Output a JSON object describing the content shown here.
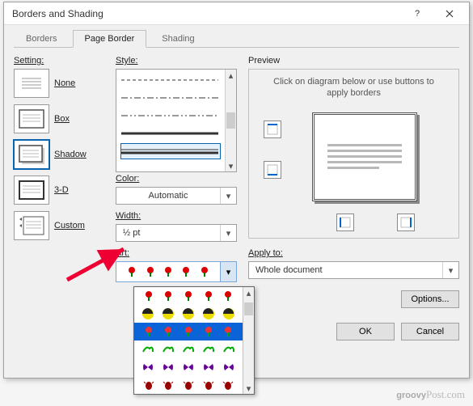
{
  "title": "Borders and Shading",
  "tabs": {
    "borders": "Borders",
    "page_border": "Page Border",
    "shading": "Shading",
    "active": "page_border"
  },
  "setting": {
    "label": "Setting:",
    "items": [
      {
        "label": "None"
      },
      {
        "label": "Box"
      },
      {
        "label": "Shadow"
      },
      {
        "label": "3-D"
      },
      {
        "label": "Custom"
      }
    ],
    "selected": "Shadow"
  },
  "style": {
    "label": "Style:"
  },
  "color": {
    "label": "Color:",
    "value": "Automatic"
  },
  "width": {
    "label": "Width:",
    "value": "½ pt"
  },
  "art": {
    "label": "Art:"
  },
  "preview": {
    "label": "Preview",
    "hint": "Click on diagram below or use buttons to apply borders"
  },
  "apply_to": {
    "label": "Apply to:",
    "value": "Whole document"
  },
  "buttons": {
    "options": "Options...",
    "ok": "OK",
    "cancel": "Cancel"
  },
  "watermark": "groovyPost.com"
}
